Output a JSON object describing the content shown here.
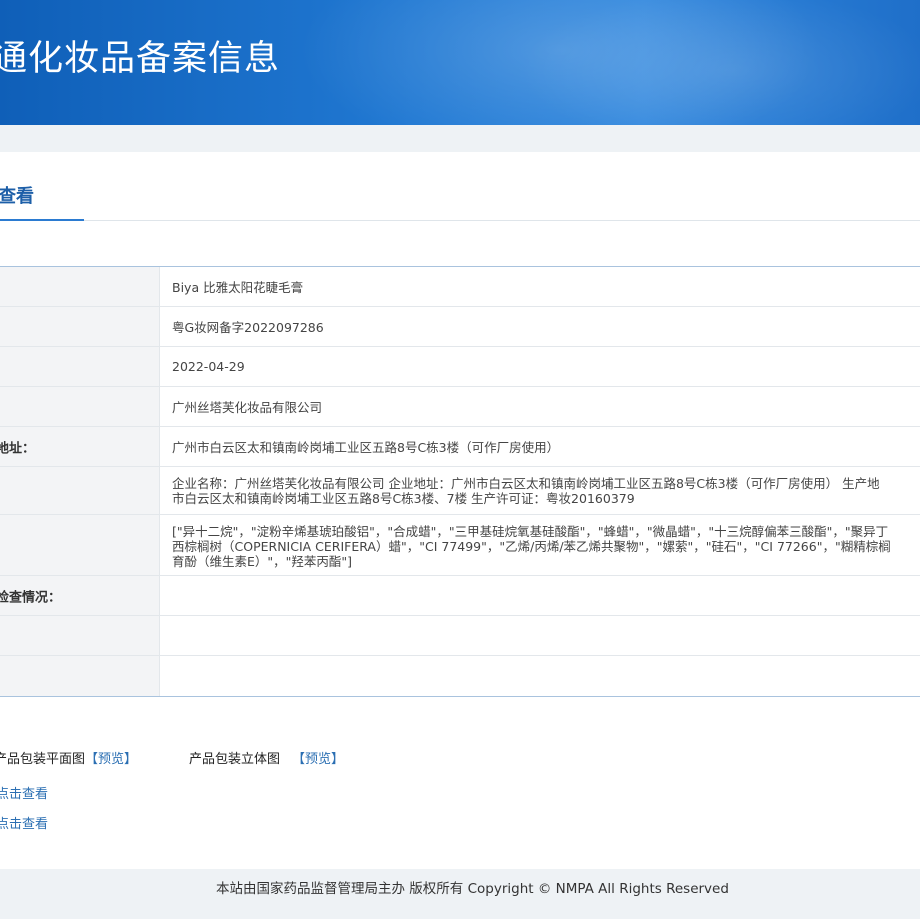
{
  "banner": {
    "title": "通化妆品备案信息"
  },
  "tab": {
    "title": "查看"
  },
  "rows": [
    {
      "label": "",
      "value": "Biya 比雅太阳花睫毛膏"
    },
    {
      "label": "",
      "value": "粤G妆网备字2022097286"
    },
    {
      "label": "",
      "value": "2022-04-29"
    },
    {
      "label": "",
      "value": "广州丝塔芙化妆品有限公司"
    },
    {
      "label": "地址：",
      "value": "广州市白云区太和镇南岭岗埔工业区五路8号C栋3楼（可作厂房使用）"
    },
    {
      "label": "",
      "lines": [
        "企业名称：广州丝塔芙化妆品有限公司 企业地址：广州市白云区太和镇南岭岗埔工业区五路8号C栋3楼（可作厂房使用） 生产地",
        "市白云区太和镇南岭岗埔工业区五路8号C栋3楼、7楼 生产许可证：粤妆20160379"
      ]
    },
    {
      "label": "",
      "lines": [
        "[\"异十二烷\"，\"淀粉辛烯基琥珀酸铝\"，\"合成蜡\"，\"三甲基硅烷氧基硅酸酯\"，\"蜂蜡\"，\"微晶蜡\"，\"十三烷醇偏苯三酸酯\"，\"聚异丁",
        "西棕榈树（COPERNICIA CERIFERA）蜡\"，\"CI 77499\"，\"乙烯/丙烯/苯乙烯共聚物\"，\"嫘萦\"，\"硅石\"，\"CI 77266\"，\"糊精棕榈",
        "育酚（维生素E）\"，\"羟苯丙酯\"]"
      ]
    },
    {
      "label": "检查情况：",
      "value": ""
    },
    {
      "label": "",
      "value": ""
    },
    {
      "label": "",
      "value": ""
    }
  ],
  "links": {
    "flat_label": "产品包装平面图",
    "flat_preview": "【预览】",
    "three_d_label": "产品包装立体图",
    "three_d_preview": "【预览】",
    "view_1": "点击查看",
    "view_2": "点击查看"
  },
  "footer": {
    "text": "本站由国家药品监督管理局主办 版权所有 Copyright © NMPA All Rights Reserved"
  }
}
